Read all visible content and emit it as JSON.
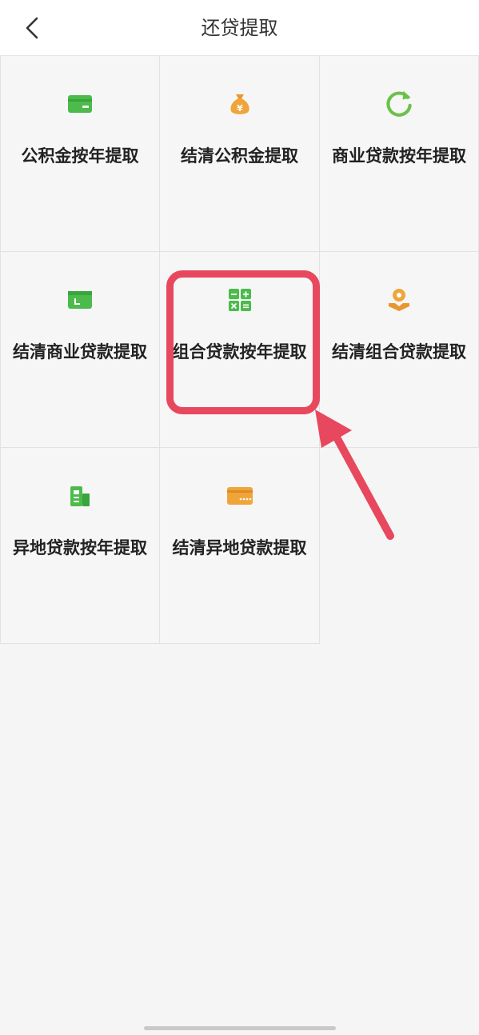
{
  "header": {
    "title": "还贷提取"
  },
  "grid": {
    "items": [
      {
        "label": "公积金按年提取",
        "icon": "card-icon",
        "color": "#4cbb4c"
      },
      {
        "label": "结清公积金提取",
        "icon": "money-bag-icon",
        "color": "#f0a53a"
      },
      {
        "label": "商业贷款按年提取",
        "icon": "refresh-icon",
        "color": "#6cc04a"
      },
      {
        "label": "结清商业贷款提取",
        "icon": "wallet-icon",
        "color": "#4cbb4c"
      },
      {
        "label": "组合贷款按年提取",
        "icon": "calculator-icon",
        "color": "#4cbb4c"
      },
      {
        "label": "结清组合贷款提取",
        "icon": "location-hand-icon",
        "color": "#f0a53a"
      },
      {
        "label": "异地贷款按年提取",
        "icon": "building-icon",
        "color": "#4cbb4c"
      },
      {
        "label": "结清异地贷款提取",
        "icon": "bank-card-icon",
        "color": "#f0a53a"
      }
    ]
  },
  "annotation": {
    "highlight_color": "#e8485e"
  }
}
